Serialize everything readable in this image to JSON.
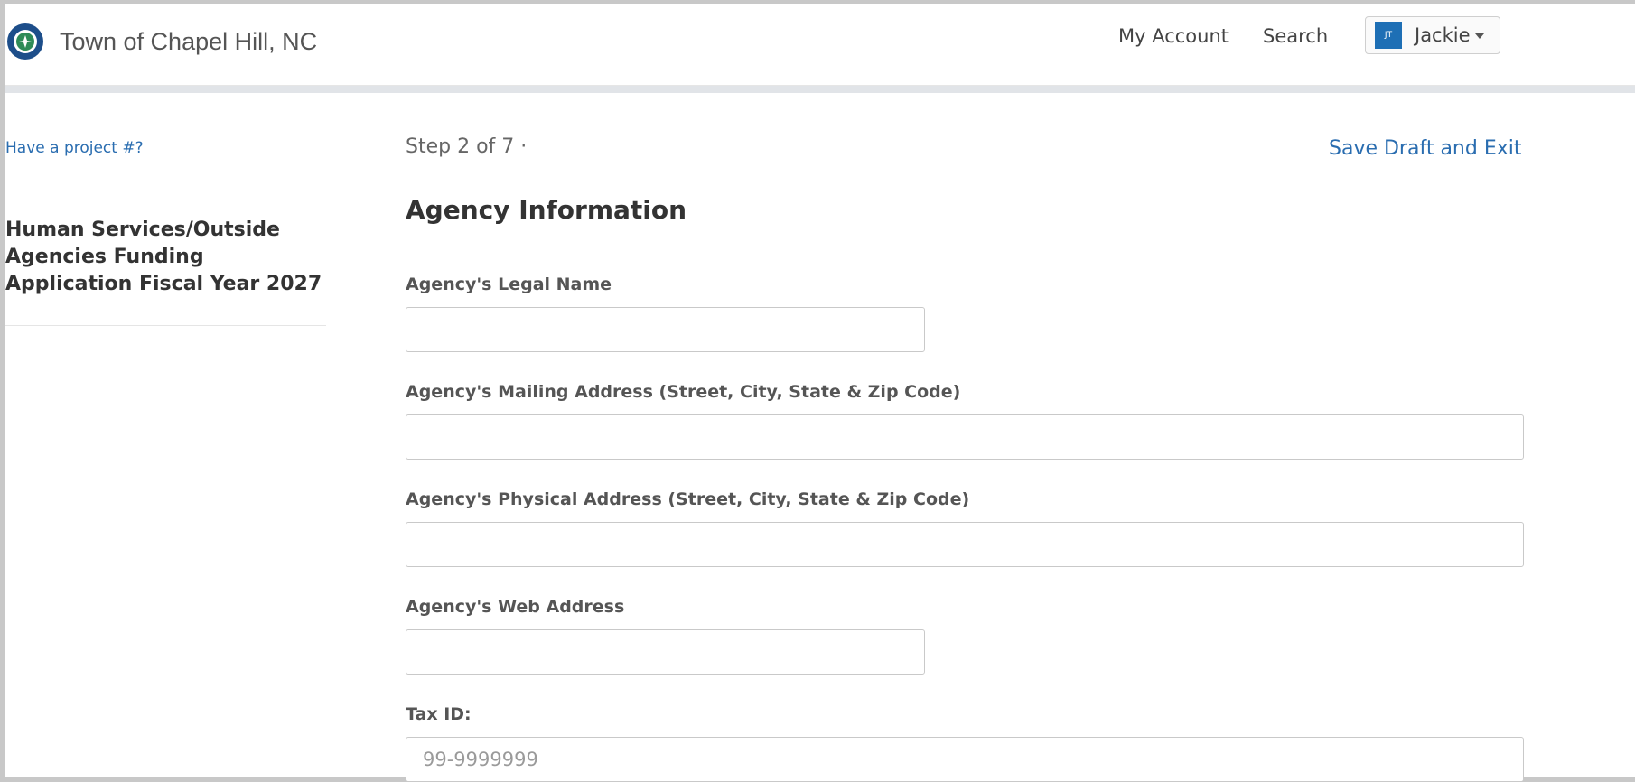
{
  "header": {
    "site_title": "Town of Chapel Hill, NC",
    "nav": {
      "my_account": "My Account",
      "search": "Search"
    },
    "user": {
      "initials": "JT",
      "name": "Jackie"
    }
  },
  "sidebar": {
    "project_link": "Have a project #?",
    "application_title": "Human Services/Outside Agencies Funding Application Fiscal Year 2027"
  },
  "main": {
    "step": "Step 2 of 7 ·",
    "save_draft": "Save Draft and Exit",
    "section_title": "Agency Information",
    "fields": {
      "legal_name": {
        "label": "Agency's Legal Name",
        "value": "",
        "placeholder": ""
      },
      "mailing_address": {
        "label": "Agency's Mailing Address (Street, City, State & Zip Code)",
        "value": "",
        "placeholder": ""
      },
      "physical_address": {
        "label": "Agency's Physical Address (Street, City, State & Zip Code)",
        "value": "",
        "placeholder": ""
      },
      "web_address": {
        "label": "Agency's Web Address",
        "value": "",
        "placeholder": ""
      },
      "tax_id": {
        "label": "Tax ID:",
        "value": "",
        "placeholder": "99-9999999"
      }
    }
  },
  "colors": {
    "link": "#2a6db0",
    "seal": "#1d4e8a",
    "avatar": "#1e6fb5"
  },
  "icons": {
    "seal": "town-seal-icon",
    "caret": "chevron-down-icon"
  }
}
